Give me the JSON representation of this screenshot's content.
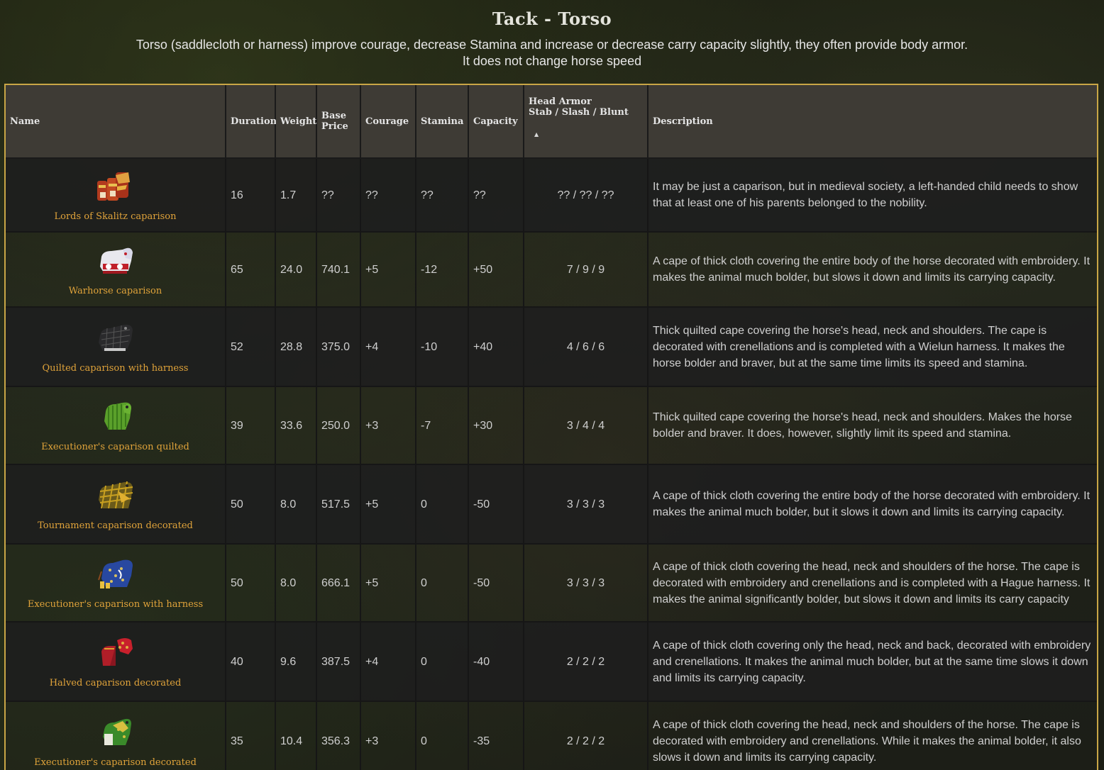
{
  "header": {
    "title": "Tack - Torso",
    "subtitle_line1": "Torso (saddlecloth or harness) improve courage, decrease Stamina and increase or decrease carry capacity slightly, they often provide body armor.",
    "subtitle_line2": "It does not change horse speed"
  },
  "table": {
    "columns": {
      "name": "Name",
      "duration": "Duration",
      "weight": "Weight",
      "price_line1": "Base",
      "price_line2": "Price",
      "courage": "Courage",
      "stamina": "Stamina",
      "capacity": "Capacity",
      "armor_line1": "Head Armor",
      "armor_line2": "Stab / Slash / Blunt",
      "description": "Description"
    },
    "sort_indicator": "▲",
    "rows": [
      {
        "name": "Lords of Skalitz caparison",
        "icon": "lords-caparison-icon",
        "duration": "16",
        "weight": "1.7",
        "price": "??",
        "courage": "??",
        "stamina": "??",
        "capacity": "??",
        "armor": "?? / ?? / ??",
        "description": "It may be just a caparison, but in medieval society, a left-handed child needs to show that at least one of his parents belonged to the nobility."
      },
      {
        "name": "Warhorse caparison",
        "icon": "warhorse-caparison-icon",
        "duration": "65",
        "weight": "24.0",
        "price": "740.1",
        "courage": "+5",
        "stamina": "-12",
        "capacity": "+50",
        "armor": "7 / 9 / 9",
        "description": "A cape of thick cloth covering the entire body of the horse decorated with embroidery. It makes the animal much bolder, but slows it down and limits its carrying capacity."
      },
      {
        "name": "Quilted caparison with harness",
        "icon": "quilted-caparison-icon",
        "duration": "52",
        "weight": "28.8",
        "price": "375.0",
        "courage": "+4",
        "stamina": "-10",
        "capacity": "+40",
        "armor": "4 / 6 / 6",
        "description": "Thick quilted cape covering the horse's head, neck and shoulders. The cape is decorated with crenellations and is completed with a Wielun harness. It makes the horse bolder and braver, but at the same time limits its speed and stamina."
      },
      {
        "name": "Executioner's caparison quilted",
        "icon": "executioner-quilted-icon",
        "duration": "39",
        "weight": "33.6",
        "price": "250.0",
        "courage": "+3",
        "stamina": "-7",
        "capacity": "+30",
        "armor": "3 / 4 / 4",
        "description": "Thick quilted cape covering the horse's head, neck and shoulders. Makes the horse bolder and braver. It does, however, slightly limit its speed and stamina."
      },
      {
        "name": "Tournament caparison decorated",
        "icon": "tournament-caparison-icon",
        "duration": "50",
        "weight": "8.0",
        "price": "517.5",
        "courage": "+5",
        "stamina": "0",
        "capacity": "-50",
        "armor": "3 / 3 / 3",
        "description": "A cape of thick cloth covering the entire body of the horse decorated with embroidery. It makes the animal much bolder, but it slows it down and limits its carrying capacity."
      },
      {
        "name": "Executioner's caparison with harness",
        "icon": "executioner-harness-icon",
        "duration": "50",
        "weight": "8.0",
        "price": "666.1",
        "courage": "+5",
        "stamina": "0",
        "capacity": "-50",
        "armor": "3 / 3 / 3",
        "description": "A cape of thick cloth covering the head, neck and shoulders of the horse. The cape is decorated with embroidery and crenellations and is completed with a Hague harness. It makes the animal significantly bolder, but slows it down and limits its carry capacity"
      },
      {
        "name": "Halved caparison decorated",
        "icon": "halved-caparison-icon",
        "duration": "40",
        "weight": "9.6",
        "price": "387.5",
        "courage": "+4",
        "stamina": "0",
        "capacity": "-40",
        "armor": "2 / 2 / 2",
        "description": "A cape of thick cloth covering only the head, neck and back, decorated with embroidery and crenellations. It makes the animal much bolder, but at the same time slows it down and limits its carrying capacity."
      },
      {
        "name": "Executioner's caparison decorated",
        "icon": "executioner-decorated-icon",
        "duration": "35",
        "weight": "10.4",
        "price": "356.3",
        "courage": "+3",
        "stamina": "0",
        "capacity": "-35",
        "armor": "2 / 2 / 2",
        "description": "A cape of thick cloth covering the head, neck and shoulders of the horse. The cape is decorated with embroidery and crenellations. While it makes the animal bolder, it also slows it down and limits its carrying capacity."
      }
    ]
  }
}
